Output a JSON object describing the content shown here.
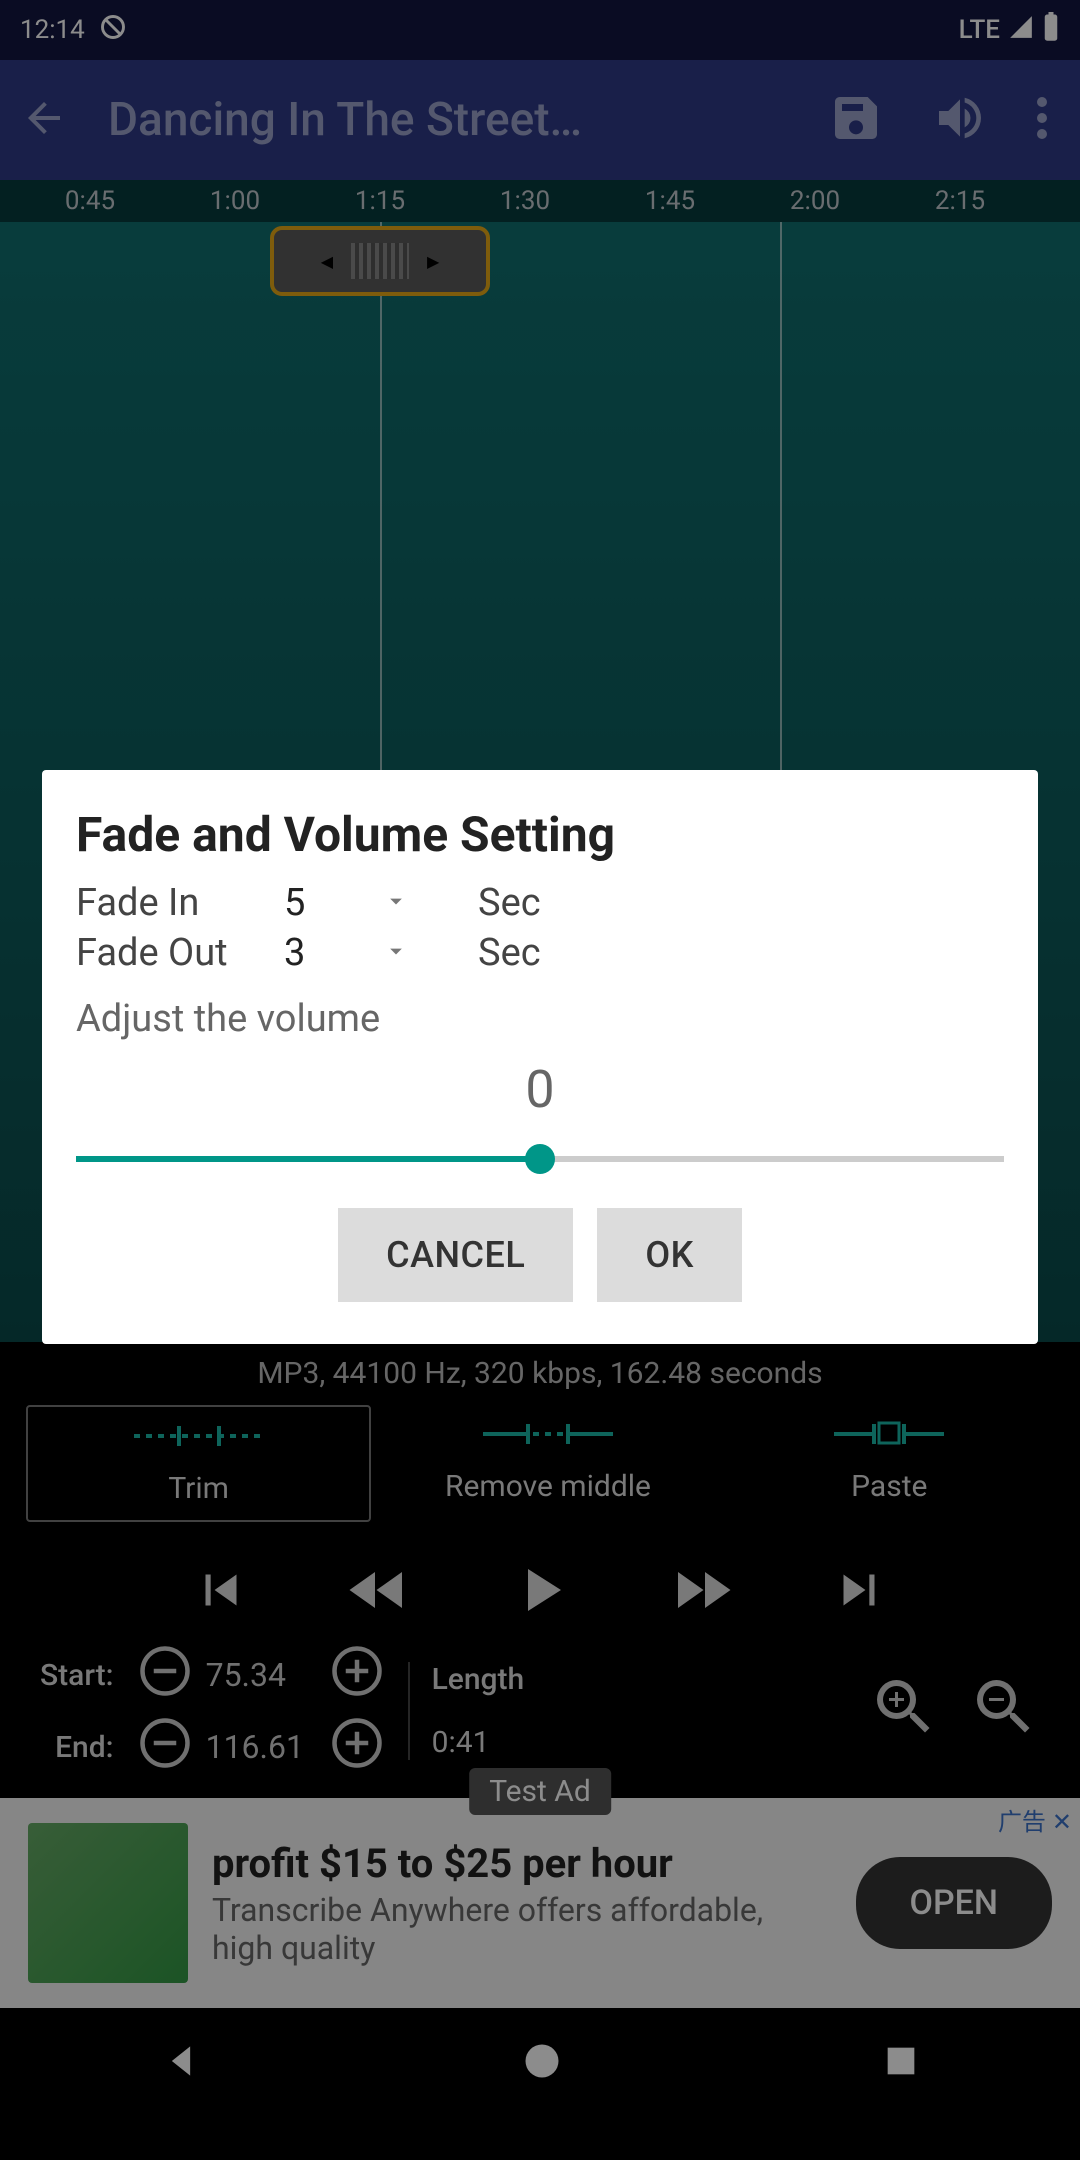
{
  "status": {
    "time": "12:14",
    "net": "LTE"
  },
  "header": {
    "title": "Dancing In The Street…"
  },
  "timeline": [
    "0:45",
    "1:00",
    "1:15",
    "1:30",
    "1:45",
    "2:00",
    "2:15"
  ],
  "fileinfo": "MP3, 44100 Hz, 320 kbps, 162.48 seconds",
  "modes": {
    "trim": "Trim",
    "remove": "Remove middle",
    "paste": "Paste"
  },
  "range": {
    "start_label": "Start:",
    "start_value": "75.34",
    "end_label": "End:",
    "end_value": "116.61",
    "length_label": "Length",
    "length_value": "0:41"
  },
  "ad": {
    "tag": "Test Ad",
    "headline": "profit $15 to $25 per hour",
    "sub": "Transcribe Anywhere offers affordable, high quality",
    "cta": "OPEN",
    "corner": "广告 ✕"
  },
  "dialog": {
    "title": "Fade and Volume Setting",
    "fade_in_label": "Fade In",
    "fade_in_value": "5",
    "sec1": "Sec",
    "fade_out_label": "Fade Out",
    "fade_out_value": "3",
    "sec2": "Sec",
    "adjust_label": "Adjust the volume",
    "volume_value": "0",
    "cancel": "CANCEL",
    "ok": "OK"
  }
}
